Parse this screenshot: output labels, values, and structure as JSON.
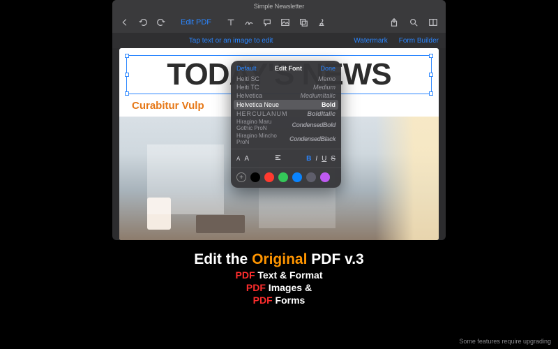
{
  "window": {
    "title": "Simple Newsletter"
  },
  "toolbar": {
    "mode": "Edit PDF"
  },
  "subbar": {
    "hint": "Tap text or an image to edit",
    "watermark": "Watermark",
    "form_builder": "Form Builder"
  },
  "doc": {
    "headline": "TODAY'S NEWS",
    "subhead": "Curabitur Vulp"
  },
  "popover": {
    "default": "Default",
    "title": "Edit Font",
    "done": "Done",
    "fonts": [
      {
        "name": "Heiti SC",
        "weight": "Memo"
      },
      {
        "name": "Heiti TC",
        "weight": "Medium"
      },
      {
        "name": "Helvetica",
        "weight": "MediumItalic"
      },
      {
        "name": "Helvetica Neue",
        "weight": "Bold",
        "selected": true
      },
      {
        "name": "HERCULANUM",
        "weight": "BoldItalic"
      },
      {
        "name": "Hiragino Maru Gothic ProN",
        "weight": "CondensedBold"
      },
      {
        "name": "Hiragino Mincho ProN",
        "weight": "CondensedBlack"
      }
    ],
    "size_small": "A",
    "size_large": "A",
    "b": "B",
    "i": "I",
    "u": "U",
    "s": "S",
    "colors": [
      "#000000",
      "#ff3a2f",
      "#34c759",
      "#0a84ff",
      "#5e5e6b",
      "#bf5af2"
    ]
  },
  "promo": {
    "h1_a": "Edit the ",
    "h1_b": "Original",
    "h1_c": " PDF v.3",
    "l1_a": "PDF",
    "l1_b": " Text & Format",
    "l2_a": "PDF",
    "l2_b": " Images &",
    "l3_a": "PDF",
    "l3_b": " Forms"
  },
  "footnote": "Some features require upgrading"
}
